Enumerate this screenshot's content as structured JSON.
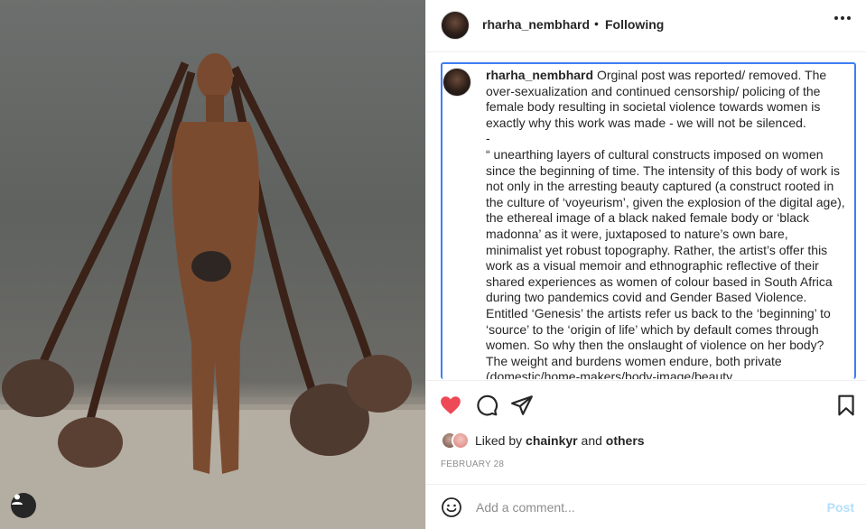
{
  "post": {
    "username": "rharha_nembhard",
    "separator": "•",
    "follow_status": "Following",
    "caption_username": "rharha_nembhard",
    "caption_text": "Orginal post was reported/ removed. The over-sexualization and continued censorship/ policing of the female body resulting in societal violence towards women is exactly why this work was made - we will not be silenced.\n-\n“ unearthing layers of cultural constructs imposed on women since the beginning of time. The intensity of this body of work is not only in the arresting beauty captured (a construct rooted in the culture of ‘voyeurism’, given the explosion of the digital age), the ethereal image of a black naked female body or ‘black madonna’ as it were, juxtaposed to nature’s own bare, minimalist yet robust topography. Rather, the artist’s offer this work as a visual memoir and ethnographic reflective of their shared experiences as women of colour based in South Africa during two pandemics covid and Gender Based Violence. Entitled ‘Genesis’ the artists refer us back to the ‘beginning’ to ‘source’ to the ‘origin of life’ which by default comes through women. So why then the onslaught of violence on her body? The weight and burdens women endure, both private (domestic/home-makers/body-image/beauty",
    "liked": true
  },
  "likes": {
    "prefix": "Liked by",
    "first_liker": "chainkyr",
    "conjunction": "and",
    "others": "others"
  },
  "date": "FEBRUARY 28",
  "comment": {
    "placeholder": "Add a comment...",
    "post_label": "Post"
  },
  "icons": {
    "more": "more-options-icon",
    "like": "heart-icon",
    "comment": "comment-icon",
    "share": "send-icon",
    "save": "bookmark-icon",
    "emoji": "emoji-icon",
    "user_tag": "user-tag-icon"
  },
  "colors": {
    "like_red": "#ed4956",
    "selection_blue": "#3d7ff2",
    "post_disabled": "#b2dffc",
    "muted": "#8e8e8e"
  }
}
